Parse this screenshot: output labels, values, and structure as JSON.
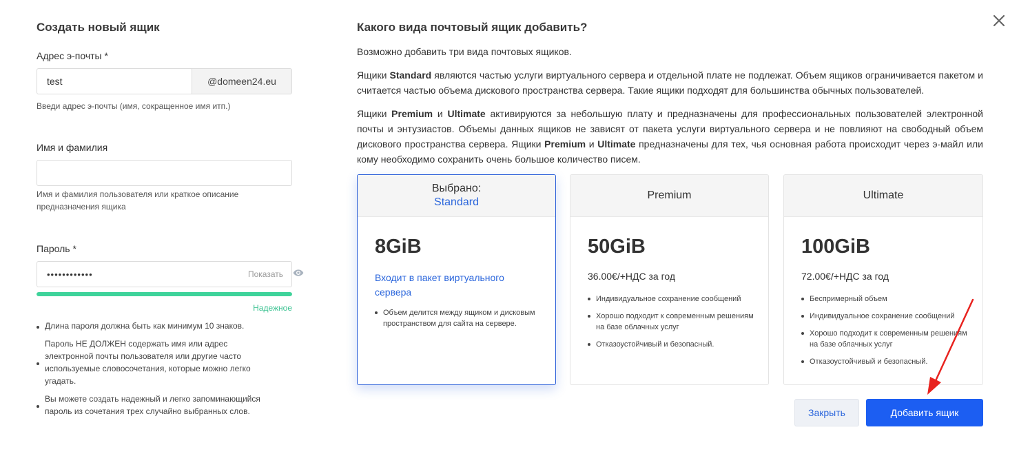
{
  "left": {
    "title": "Создать новый ящик",
    "email": {
      "label": "Адрес э-почты *",
      "value": "test",
      "domain": "@domeen24.eu",
      "hint": "Введи адрес э-почты (имя, сокращенное имя итп.)"
    },
    "name": {
      "label": "Имя и фамилия",
      "value": "",
      "hint": "Имя и фамилия пользователя или краткое описание предназначения ящика"
    },
    "password": {
      "label": "Пароль *",
      "value": "••••••••••••",
      "show_label": "Показать",
      "strength_label": "Надежное",
      "strength_fraction": 1.0,
      "rules": [
        "Длина пароля должна быть как минимум 10 знаков.",
        "Пароль НЕ ДОЛЖЕН содержать имя или адрес электронной почты пользователя или другие часто используемые словосочетания, которые можно легко угадать.",
        "Вы можете создать надежный и легко запоминающийся пароль из сочетания трех случайно выбранных слов."
      ]
    }
  },
  "right": {
    "title": "Какого вида почтовый ящик добавить?",
    "intro": "Возможно добавить три вида почтовых ящиков.",
    "p1": {
      "pre": "Ящики ",
      "b1": "Standard",
      "post": " являются частью услуги виртуального сервера и отдельной плате не подлежат. Объем ящиков ограничивается пакетом и считается частью объема дискового пространства сервера. Такие ящики подходят для большинства обычных пользователей."
    },
    "p2": {
      "s1": "Ящики ",
      "b1": "Premium",
      "s2": " и ",
      "b2": "Ultimate",
      "s3": " активируются за небольшую плату и предназначены для профессиональных пользователей электронной почты и энтузиастов. Объемы данных ящиков не зависят от пакета услуги виртуального сервера и не повлияют на свободный объем дискового пространства сервера. Ящики ",
      "b3": "Premium",
      "s4": " и ",
      "b4": "Ultimate",
      "s5": " предназначены для тех, чья основная работа происходит через э-майл или кому необходимо сохранить очень большое количество писем."
    },
    "cards": [
      {
        "head1": "Выбрано:",
        "head2": "Standard",
        "size": "8GiB",
        "price": "Входит в пакет виртуального сервера",
        "features": [
          "Объем делится между ящиком и дисковым пространством для сайта на сервере."
        ]
      },
      {
        "head1": "Premium",
        "size": "50GiB",
        "price": "36.00€/+НДС за год",
        "features": [
          "Индивидуальное сохранение сообщений",
          "Хорошо подходит к современным решениям на базе облачных услуг",
          "Отказоустойчивый и безопасный."
        ]
      },
      {
        "head1": "Ultimate",
        "size": "100GiB",
        "price": "72.00€/+НДС за год",
        "features": [
          "Беспримерный объем",
          "Индивидуальное сохранение сообщений",
          "Хорошо подходит к современным решениям на базе облачных услуг",
          "Отказоустойчивый и безопасный."
        ]
      }
    ]
  },
  "buttons": {
    "close": "Закрыть",
    "add": "Добавить ящик"
  },
  "icons": {
    "close": "close-icon",
    "eye": "eye-icon",
    "arrow": "arrow-annotation"
  },
  "colors": {
    "accent": "#1c5ef2",
    "link": "#2b66dc",
    "strength": "#3ed39a",
    "arrow": "#e8231f"
  }
}
